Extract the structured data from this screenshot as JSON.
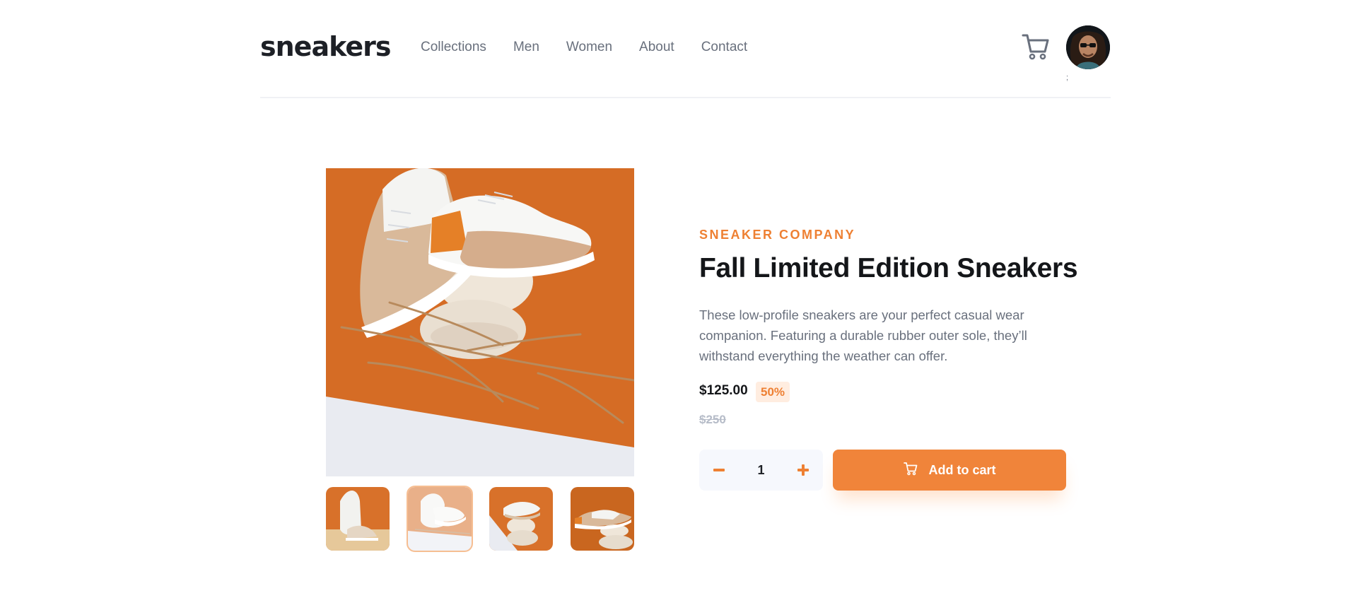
{
  "header": {
    "logo": "sneakers",
    "nav": [
      "Collections",
      "Men",
      "Women",
      "About",
      "Contact"
    ],
    "cart_icon": "cart-icon",
    "avatar_icon": "avatar",
    "avatar_note": ";"
  },
  "gallery": {
    "main_image": "sneaker-on-stones-photo",
    "thumbnails": [
      "thumbnail-1",
      "thumbnail-2",
      "thumbnail-3",
      "thumbnail-4"
    ],
    "active_thumbnail": 2
  },
  "product": {
    "company": "SNEAKER COMPANY",
    "title": "Fall Limited Edition Sneakers",
    "description": "These low-profile sneakers are your perfect casual wear companion. Featuring a durable rubber outer sole, they’ll withstand everything the weather can offer.",
    "price": "$125.00",
    "discount": "50%",
    "original_price": "$250"
  },
  "cart_controls": {
    "quantity": "1",
    "minus_icon": "minus-icon",
    "plus_icon": "plus-icon",
    "add_label": "Add to cart"
  },
  "colors": {
    "accent": "#ee8033",
    "accent_light": "#ffede0",
    "text_dark": "#1d2026",
    "text_muted": "#69707d",
    "text_faint": "#b6bcc8",
    "surface": "#f6f8fd"
  }
}
